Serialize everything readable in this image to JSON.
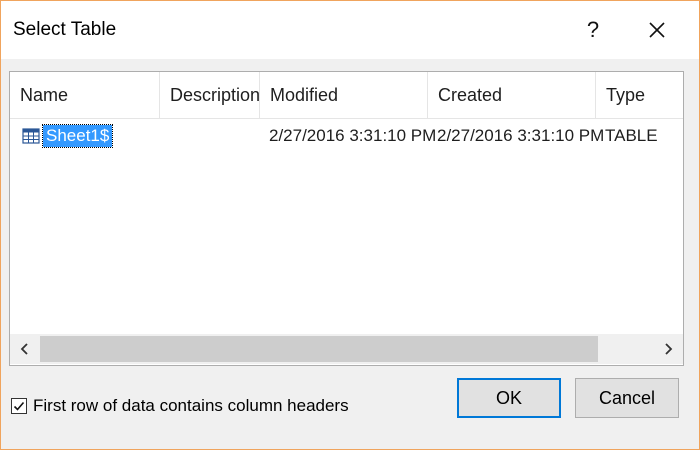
{
  "dialog": {
    "title": "Select Table",
    "help_label": "?",
    "close_icon": "close-icon"
  },
  "table": {
    "columns": [
      "Name",
      "Description",
      "Modified",
      "Created",
      "Type"
    ],
    "rows": [
      {
        "name": "Sheet1$",
        "description": "",
        "modified": "2/27/2016 3:31:10 PM",
        "created": "2/27/2016 3:31:10 PM",
        "type": "TABLE",
        "icon": "table-icon",
        "selected": true
      }
    ]
  },
  "options": {
    "first_row_headers_label": "First row of data contains column headers",
    "first_row_headers_checked": true
  },
  "buttons": {
    "ok": "OK",
    "cancel": "Cancel"
  },
  "colors": {
    "accent": "#0078d7",
    "selection": "#3399ff",
    "border": "#f0a45d"
  }
}
